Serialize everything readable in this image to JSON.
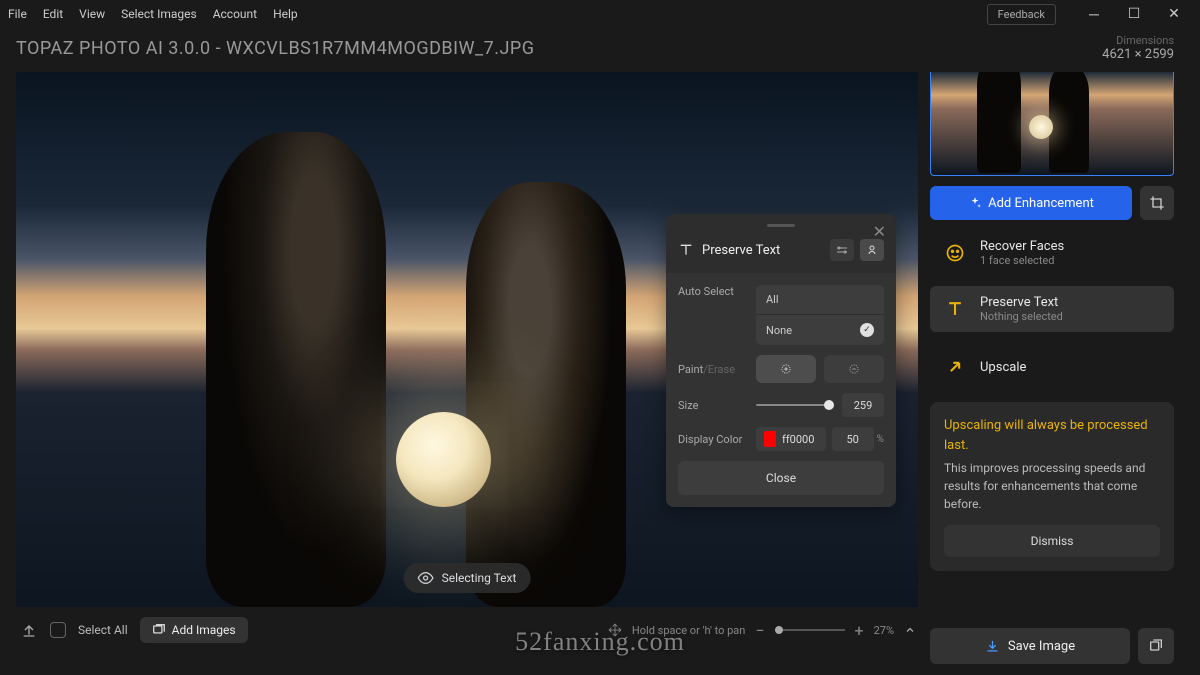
{
  "menu": {
    "items": [
      "File",
      "Edit",
      "View",
      "Select Images",
      "Account",
      "Help"
    ]
  },
  "feedback": "Feedback",
  "title": "TOPAZ PHOTO AI 3.0.0 - WXCVLBS1R7MM4MOGDBIW_7.JPG",
  "dimensions": {
    "label": "Dimensions",
    "value": "4621 × 2599"
  },
  "selecting_pill": "Selecting Text",
  "panel": {
    "title": "Preserve Text",
    "auto_select_label": "Auto Select",
    "opt_all": "All",
    "opt_none": "None",
    "paint_label": "Paint",
    "erase_label": "Erase",
    "size_label": "Size",
    "size_value": "259",
    "color_label": "Display Color",
    "color_value": "ff0000",
    "opacity_value": "50",
    "opacity_unit": "%",
    "close": "Close"
  },
  "bottombar": {
    "select_all": "Select All",
    "add_images": "Add Images",
    "hint": "Hold space or 'h' to pan",
    "zoom": "27%"
  },
  "sidebar": {
    "add_enh": "Add Enhancement",
    "items": [
      {
        "title": "Recover Faces",
        "sub": "1 face selected"
      },
      {
        "title": "Preserve Text",
        "sub": "Nothing selected"
      }
    ],
    "upscale": "Upscale",
    "notice_title": "Upscaling will always be processed last.",
    "notice_body": "This improves processing speeds and results for enhancements that come before.",
    "dismiss": "Dismiss",
    "save": "Save Image"
  },
  "watermark": "52fanxing.com"
}
